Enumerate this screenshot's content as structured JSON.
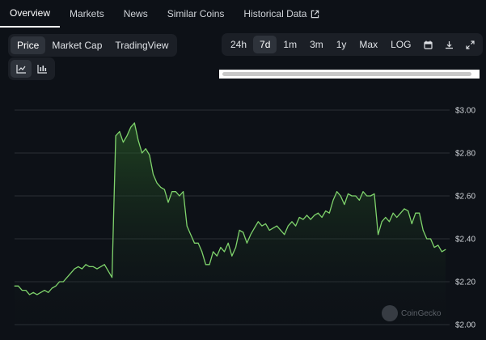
{
  "tabs": [
    {
      "label": "Overview",
      "active": true
    },
    {
      "label": "Markets"
    },
    {
      "label": "News"
    },
    {
      "label": "Similar Coins"
    },
    {
      "label": "Historical Data",
      "icon": "external-link-icon"
    }
  ],
  "metric_toggle": [
    "Price",
    "Market Cap",
    "TradingView"
  ],
  "chart_type_icons": [
    "line-chart-icon",
    "candlestick-chart-icon"
  ],
  "range_buttons": [
    "24h",
    "7d",
    "1m",
    "3m",
    "1y",
    "Max",
    "LOG"
  ],
  "range_selected": "7d",
  "tool_icons": [
    "calendar-icon",
    "download-icon",
    "expand-icon"
  ],
  "watermark": "CoinGecko",
  "colors": {
    "line": "#7fd36c",
    "background": "#0d1117",
    "grid": "#2a2f36"
  },
  "chart_data": {
    "type": "area",
    "y_ticks": [
      "$3.00",
      "$2.80",
      "$2.60",
      "$2.40",
      "$2.20",
      "$2.00"
    ],
    "ylim": [
      2.0,
      3.0
    ],
    "grid": true,
    "values": [
      2.18,
      2.18,
      2.16,
      2.16,
      2.14,
      2.15,
      2.14,
      2.15,
      2.16,
      2.15,
      2.17,
      2.18,
      2.2,
      2.2,
      2.22,
      2.24,
      2.26,
      2.27,
      2.26,
      2.28,
      2.27,
      2.27,
      2.26,
      2.27,
      2.28,
      2.25,
      2.22,
      2.88,
      2.9,
      2.85,
      2.88,
      2.92,
      2.94,
      2.86,
      2.8,
      2.82,
      2.79,
      2.7,
      2.66,
      2.64,
      2.63,
      2.57,
      2.62,
      2.62,
      2.6,
      2.62,
      2.46,
      2.42,
      2.38,
      2.38,
      2.34,
      2.28,
      2.28,
      2.34,
      2.32,
      2.36,
      2.34,
      2.38,
      2.32,
      2.36,
      2.44,
      2.43,
      2.38,
      2.42,
      2.45,
      2.48,
      2.46,
      2.47,
      2.44,
      2.45,
      2.46,
      2.44,
      2.42,
      2.46,
      2.48,
      2.46,
      2.5,
      2.49,
      2.51,
      2.49,
      2.51,
      2.52,
      2.5,
      2.53,
      2.52,
      2.58,
      2.62,
      2.6,
      2.56,
      2.61,
      2.6,
      2.6,
      2.58,
      2.62,
      2.6,
      2.6,
      2.61,
      2.42,
      2.48,
      2.5,
      2.48,
      2.52,
      2.5,
      2.52,
      2.54,
      2.53,
      2.47,
      2.52,
      2.52,
      2.44,
      2.4,
      2.4,
      2.36,
      2.37,
      2.34,
      2.35
    ]
  }
}
